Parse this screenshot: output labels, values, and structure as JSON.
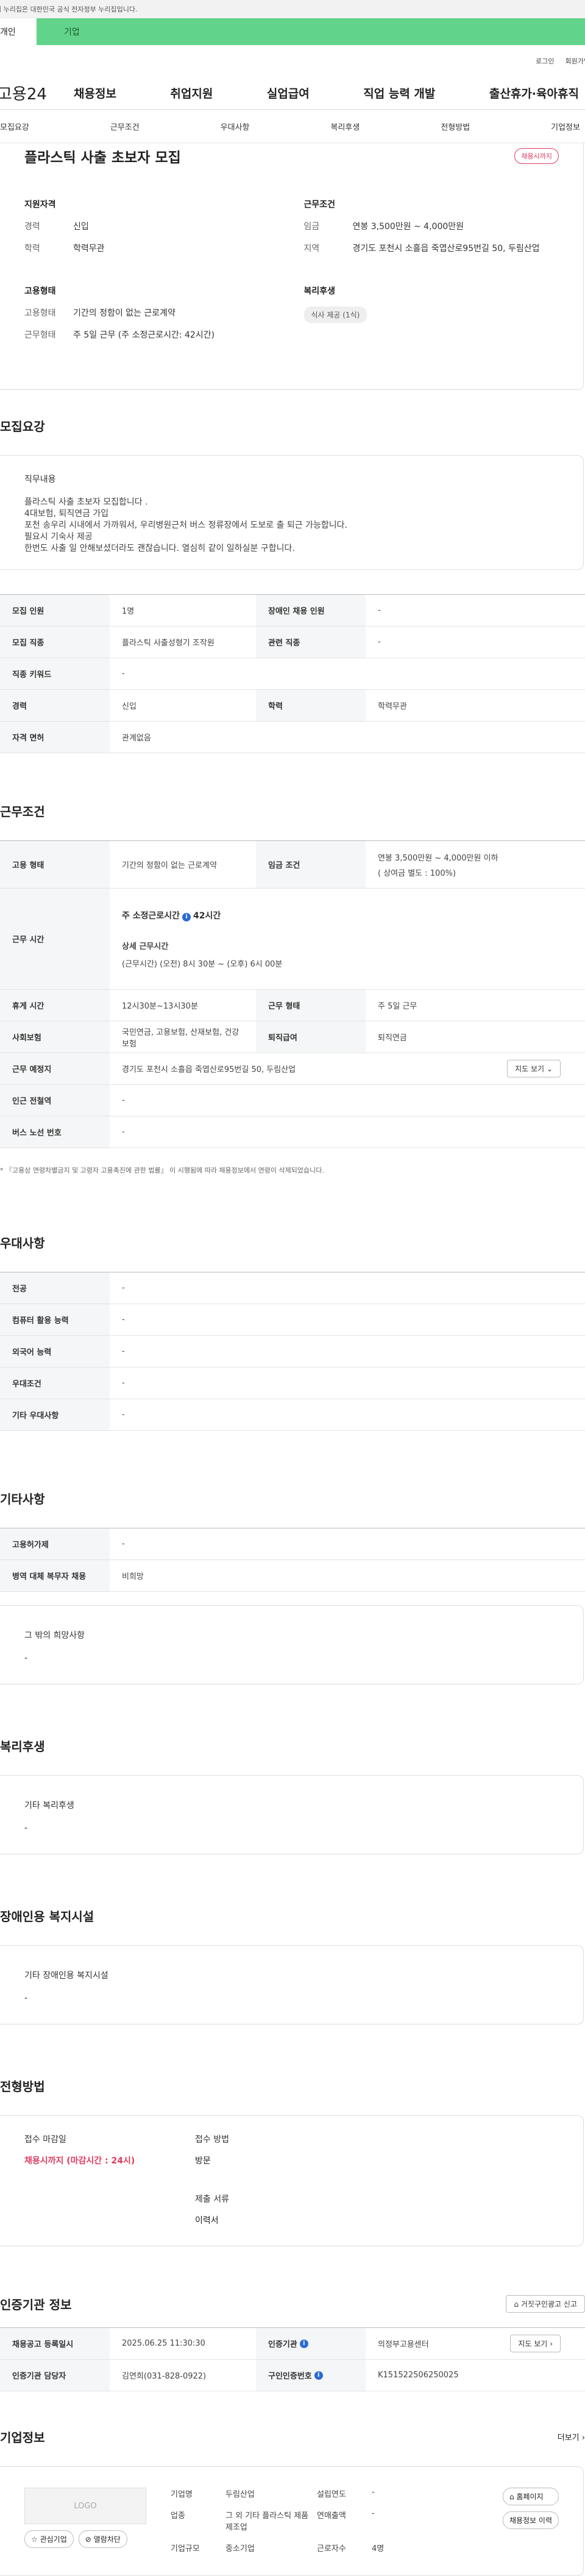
{
  "gov_banner": "이 누리집은 대한민국 공식 전자정부 누리집입니다.",
  "tabs": {
    "individual": "개인",
    "company": "기업"
  },
  "util": {
    "login": "로그인",
    "signup": "회원가입"
  },
  "logo": "고용24",
  "nav": [
    "채용정보",
    "취업지원",
    "실업급여",
    "직업 능력 개발",
    "출산휴가·육아휴직"
  ],
  "subtabs": [
    "모집요강",
    "근무조건",
    "우대사항",
    "복리후생",
    "전형방법",
    "기업정보"
  ],
  "summary": {
    "title": "플라스틱 사출 초보자 모집",
    "badge": "채용시까지",
    "qualify": {
      "heading": "지원자격",
      "career_label": "경력",
      "career_value": "신입",
      "edu_label": "학력",
      "edu_value": "학력무관"
    },
    "work": {
      "heading": "근무조건",
      "wage_label": "임금",
      "wage_value": "연봉 3,500만원 ~ 4,000만원",
      "place_label": "지역",
      "place_value": "경기도 포천시 소흘읍 죽엽산로95번길 50, 두림산업"
    },
    "employ": {
      "heading": "고용형태",
      "type_label": "고용형태",
      "type_value": "기간의 정함이 없는 근로계약",
      "form_label": "근무형태",
      "form_value": "주 5일 근무 (주 소정근로시간: 42시간)"
    },
    "welfare": {
      "heading": "복리후생",
      "tag": "식사 제공 (1식)"
    }
  },
  "recruit": {
    "title": "모집요강",
    "duty_heading": "직무내용",
    "duty_lines": [
      "플라스틱 사출 초보자 모집합니다 .",
      "4대보험, 퇴직연금 가입",
      "포천 송우리 시내에서 가까워서, 우리병원근처 버스 정류장에서 도보로 출 퇴근 가능합니다.",
      "필요시 기숙사 제공",
      "한번도 사출 일 안해보셨더라도 괜찮습니다. 열심히 같이 일하실분 구합니다."
    ],
    "rows": [
      [
        "모집 인원",
        "1명",
        "장애인 채용 인원",
        "-"
      ],
      [
        "모집 직종",
        "플라스틱 사출성형기 조작원",
        "관련 직종",
        "-"
      ],
      [
        "직종 키워드",
        "-"
      ],
      [
        "경력",
        "신입",
        "학력",
        "학력무관"
      ],
      [
        "자격 면허",
        "관계없음"
      ]
    ]
  },
  "work_cond": {
    "title": "근무조건",
    "employ_type_h": "고용 형태",
    "employ_type_v": "기간의 정함이 없는 근로계약",
    "wage_h": "임금 조건",
    "wage_v1": "연봉 3,500만원 ~ 4,000만원 이하",
    "wage_v2": "( 상여금 별도 : 100%)",
    "hours_h": "근무 시간",
    "hours_week": "주 소정근로시간",
    "hours_week_val": "42시간",
    "hours_detail_t": "상세 근무시간",
    "hours_detail_v": "(근무시간) (오전) 8시 30분 ~ (오후) 6시 00분",
    "rows": [
      [
        "휴게 시간",
        "12시30분~13시30분",
        "근무 형태",
        "주 5일 근무"
      ],
      [
        "사회보험",
        "국민연금, 고용보험, 산재보험, 건강보험",
        "퇴직급여",
        "퇴직연금"
      ]
    ],
    "place_h": "근무 예정지",
    "place_v": "경기도 포천시 소흘읍 죽엽산로95번길 50, 두림산업",
    "map_btn": "지도 보기",
    "near_h": "인근 전철역",
    "near_v": "-",
    "bus_h": "버스 노선 번호",
    "bus_v": "-",
    "note": "* 『고용상 연령차별금지 및 고령자 고용촉진에 관한 법률』 이 시행됨에 따라 채용정보에서 연령이 삭제되었습니다."
  },
  "prefer": {
    "title": "우대사항",
    "rows": [
      [
        "전공",
        "-"
      ],
      [
        "컴퓨터 활용 능력",
        "-"
      ],
      [
        "외국어 능력",
        "-"
      ],
      [
        "우대조건",
        "-"
      ],
      [
        "기타 우대사항",
        "-"
      ]
    ]
  },
  "etc": {
    "title": "기타사항",
    "rows": [
      [
        "고용허가제",
        "-"
      ],
      [
        "병역 대체 복무자 채용",
        "비희망"
      ]
    ],
    "box_heading": "그 밖의 희망사항",
    "box_value": "-"
  },
  "welfare": {
    "title": "복리후생",
    "heading": "기타 복리후생",
    "value": "-"
  },
  "disabled": {
    "title": "장애인용 복지시설",
    "heading": "기타 장애인용 복지시설",
    "value": "-"
  },
  "selection": {
    "title": "전형방법",
    "deadline_label": "접수 마감일",
    "deadline_value": "채용시까지 (마감시간 : 24시)",
    "method_label": "접수 방법",
    "method_value": "방문",
    "docs_label": "제출 서류",
    "docs_value": "이력서"
  },
  "agency": {
    "title": "인증기관 정보",
    "report_btn": "거짓구인광고 신고",
    "reg_h": "채용공고 등록일시",
    "reg_v": "2025.06.25 11:30:30",
    "org_h": "인증기관",
    "org_v": "의정부고용센터",
    "org_btn": "지도 보기",
    "manager_h": "인증기관 담당자",
    "manager_v": "김연희(031-828-0922)",
    "num_h": "구인인증번호",
    "num_v": "K151522506250025"
  },
  "company": {
    "title": "기업정보",
    "more": "더보기",
    "logo": "LOGO",
    "fav_btn": "관심기업",
    "block_btn": "열람차단",
    "name_h": "기업명",
    "name_v": "두림산업",
    "industry_h": "업종",
    "industry_v": "그 외 기타 플라스틱 제품 제조업",
    "size_h": "기업규모",
    "size_v": "중소기업",
    "year_h": "설립연도",
    "year_v": "-",
    "sales_h": "연매출액",
    "sales_v": "-",
    "emp_h": "근로자수",
    "emp_v": "4명",
    "home_btn": "홈페이지",
    "history_btn": "채용정보 이력"
  }
}
